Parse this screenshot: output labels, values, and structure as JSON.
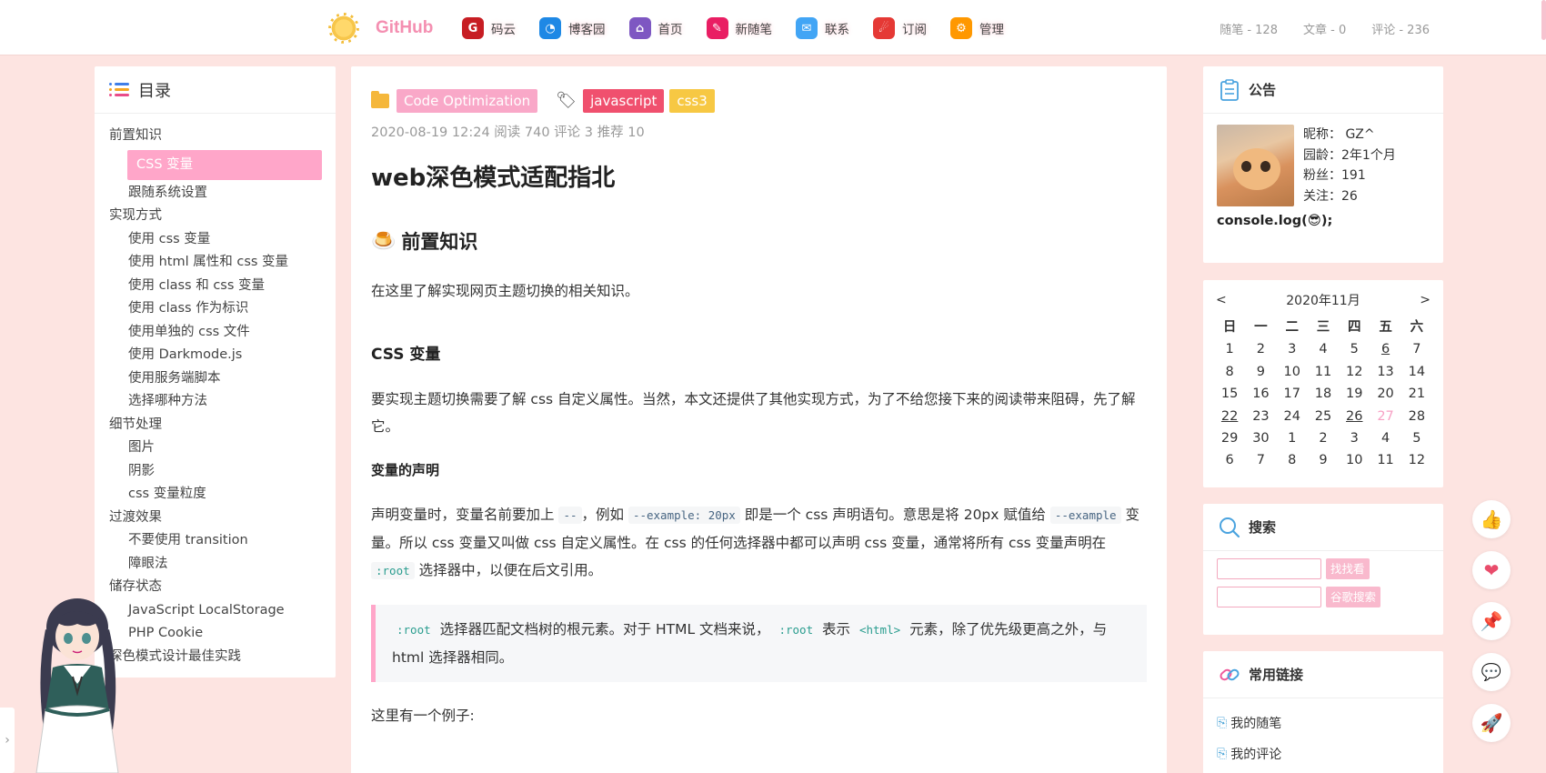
{
  "nav": {
    "brand": "GitHub",
    "items": [
      {
        "label": "码云",
        "icon": "gitee-icon",
        "color": "#c71d23",
        "glyph": "G"
      },
      {
        "label": "博客园",
        "icon": "rss-icon",
        "color": "#1e88e5",
        "glyph": "◔"
      },
      {
        "label": "首页",
        "icon": "house-icon",
        "color": "#7e57c2",
        "glyph": "⌂"
      },
      {
        "label": "新随笔",
        "icon": "pencil-cup-icon",
        "color": "#e91e63",
        "glyph": "✎"
      },
      {
        "label": "联系",
        "icon": "contact-icon",
        "color": "#42a5f5",
        "glyph": "✉"
      },
      {
        "label": "订阅",
        "icon": "subscribe-icon",
        "color": "#e53935",
        "glyph": "☄"
      },
      {
        "label": "管理",
        "icon": "gear-icon",
        "color": "#ff9800",
        "glyph": "⚙"
      }
    ],
    "stats": [
      "随笔 - 128",
      "文章 - 0",
      "评论 - 236"
    ]
  },
  "toc": {
    "title": "目录",
    "items": [
      {
        "label": "前置知识",
        "level": 1
      },
      {
        "label": "CSS 变量",
        "level": 2,
        "active": true
      },
      {
        "label": "跟随系统设置",
        "level": 2
      },
      {
        "label": "实现方式",
        "level": 1
      },
      {
        "label": "使用 css 变量",
        "level": 2
      },
      {
        "label": "使用 html 属性和 css 变量",
        "level": 2
      },
      {
        "label": "使用 class 和 css 变量",
        "level": 2
      },
      {
        "label": "使用 class 作为标识",
        "level": 2
      },
      {
        "label": "使用单独的 css 文件",
        "level": 2
      },
      {
        "label": "使用 Darkmode.js",
        "level": 2
      },
      {
        "label": "使用服务端脚本",
        "level": 2
      },
      {
        "label": "选择哪种方法",
        "level": 2
      },
      {
        "label": "细节处理",
        "level": 1
      },
      {
        "label": "图片",
        "level": 2
      },
      {
        "label": "阴影",
        "level": 2
      },
      {
        "label": "css 变量粒度",
        "level": 2
      },
      {
        "label": "过渡效果",
        "level": 1
      },
      {
        "label": "不要使用 transition",
        "level": 2
      },
      {
        "label": "障眼法",
        "level": 2
      },
      {
        "label": "储存状态",
        "level": 1
      },
      {
        "label": "JavaScript LocalStorage",
        "level": 2
      },
      {
        "label": "PHP Cookie",
        "level": 2
      },
      {
        "label": "深色模式设计最佳实践",
        "level": 1
      }
    ]
  },
  "article": {
    "category": "Code Optimization",
    "tags": [
      "javascript",
      "css3"
    ],
    "meta": "2020-08-19 12:24 阅读 740 评论 3 推荐 10",
    "title": "web深色模式适配指北",
    "h2_emoji": "🍮",
    "h2": "前置知识",
    "p1": "在这里了解实现网页主题切换的相关知识。",
    "h3": "CSS 变量",
    "p2": "要实现主题切换需要了解 css 自定义属性。当然，本文还提供了其他实现方式，为了不给您接下来的阅读带来阻碍，先了解它。",
    "h4": "变量的声明",
    "p3": {
      "a": "声明变量时，变量名前要加上 ",
      "c1": "--",
      "b": "，例如 ",
      "c2": "--example: 20px",
      "c": " 即是一个 css 声明语句。意思是将 20px 赋值给 ",
      "c3": "--example",
      "d": " 变量。所以 css 变量又叫做 css 自定义属性。在 css 的任何选择器中都可以声明 css 变量，通常将所有 css 变量声明在 ",
      "c4": ":root",
      "e": " 选择器中，以便在后文引用。"
    },
    "quote": {
      "c1": ":root",
      "a": " 选择器匹配文档树的根元素。对于 HTML 文档来说， ",
      "c2": ":root",
      "b": " 表示 ",
      "c3": "<html>",
      "c": " 元素，除了优先级更高之外，与 html 选择器相同。"
    },
    "p4": "这里有一个例子:"
  },
  "notice": {
    "title": "公告",
    "nickname": "昵称：  GZ^",
    "age": "园龄：2年1个月",
    "fans": "粉丝：191",
    "follow": "关注：26",
    "console": "console.log(😎);"
  },
  "calendar": {
    "prev": "<",
    "next": ">",
    "month": "2020年11月",
    "weekdays": [
      "日",
      "一",
      "二",
      "三",
      "四",
      "五",
      "六"
    ],
    "days": [
      "1",
      "2",
      "3",
      "4",
      "5",
      "6",
      "7",
      "8",
      "9",
      "10",
      "11",
      "12",
      "13",
      "14",
      "15",
      "16",
      "17",
      "18",
      "19",
      "20",
      "21",
      "22",
      "23",
      "24",
      "25",
      "26",
      "27",
      "28",
      "29",
      "30",
      "1",
      "2",
      "3",
      "4",
      "5",
      "6",
      "7",
      "8",
      "9",
      "10",
      "11",
      "12"
    ],
    "underlined": [
      "6",
      "22",
      "26"
    ],
    "today": "27"
  },
  "search": {
    "title": "搜索",
    "btn1": "找找看",
    "btn2": "谷歌搜索"
  },
  "links": {
    "title": "常用链接",
    "items": [
      "我的随笔",
      "我的评论"
    ]
  },
  "float": [
    "thumbs-up-icon",
    "heart-icon",
    "pin-icon",
    "comment-icon",
    "rocket-icon"
  ],
  "colors": {
    "accent": "#ffa6c9",
    "background": "#fde4e1",
    "tag_category": "#f9a8c8",
    "tag_js": "#f0506e",
    "tag_css": "#f7c843"
  }
}
